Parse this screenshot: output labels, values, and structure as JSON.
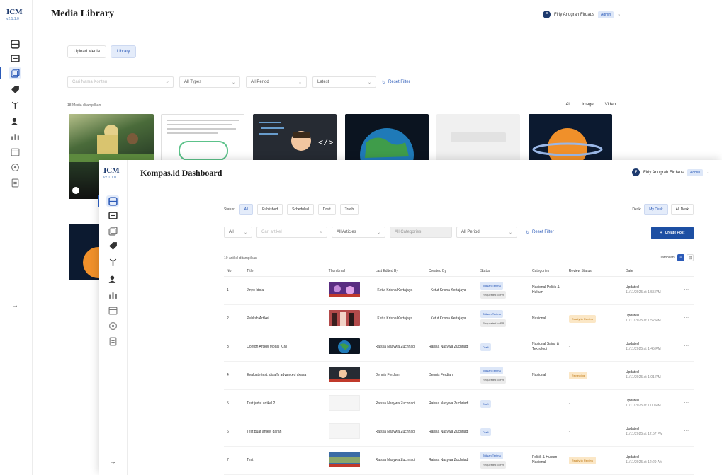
{
  "media_library": {
    "logo_main": "ICM",
    "logo_sub": "v2.1.1.0",
    "title": "Media Library",
    "user": {
      "avatar": "F",
      "name": "Firly Anugrah Firdaus",
      "role": "Admin",
      "chevron": "⌄"
    },
    "tabs": [
      {
        "label": "Upload Media"
      },
      {
        "label": "Library"
      }
    ],
    "filters": {
      "search_placeholder": "Cari Nama Konten",
      "type": "All Types",
      "period": "All Period",
      "sort": "Latest",
      "reset": "Reset Filter"
    },
    "count": "18 Media ditampilkan",
    "type_segments": [
      "All",
      "Image",
      "Video"
    ],
    "collapse_icon": "→"
  },
  "dashboard": {
    "logo_main": "ICM",
    "logo_sub": "v2.1.1.0",
    "title": "Kompas.id Dashboard",
    "user": {
      "avatar": "F",
      "name": "Firly Anugrah Firdaus",
      "role": "Admin",
      "chevron": "⌄"
    },
    "status_label": "Status:",
    "status_pills": [
      "All",
      "Published",
      "Scheduled",
      "Draft",
      "Trash"
    ],
    "desk_label": "Desk:",
    "desk_pills": [
      "My Desk",
      "All Desk"
    ],
    "filters": {
      "scope": "All",
      "search_placeholder": "Cari artikel",
      "articles": "All Articles",
      "categories": "All Categories",
      "period": "All Period",
      "reset": "Reset Filter"
    },
    "create_button": "Create Post",
    "count": "10 artikel ditampilkan",
    "view_label": "Tampilan:",
    "columns": [
      "No",
      "Title",
      "Thumbnail",
      "Last Edited By",
      "Created By",
      "Status",
      "Categories",
      "Review Status",
      "Date"
    ],
    "rows": [
      {
        "no": "1",
        "title": "Jinyo Idola",
        "edited": "I Ketut Krisna Kertajaya",
        "created": "I Ketut Krisna Kertajaya",
        "status": [
          "Tulisan Terima",
          "Requested to PR"
        ],
        "categories": "Nasional Politik & Hukum",
        "review": "-",
        "date_label": "Updated",
        "date": "11/11/2025 at 1:55 PM",
        "thumb": "purple"
      },
      {
        "no": "2",
        "title": "Publish Artikel",
        "edited": "I Ketut Krisna Kertajaya",
        "created": "I Ketut Krisna Kertajaya",
        "status": [
          "Tulisan Terima",
          "Requested to PR"
        ],
        "categories": "Nasional",
        "review": "Ready to Review",
        "date_label": "Updated",
        "date": "11/11/2025 at 1:52 PM",
        "thumb": "people"
      },
      {
        "no": "3",
        "title": "Contoh Artikel Modal ICM",
        "edited": "Raissa Nasywa Zuchriadi",
        "created": "Raissa Nasywa Zuchriadi",
        "status": [
          "Draft"
        ],
        "categories": "Nasional Sains & Teknologi",
        "review": "-",
        "date_label": "Updated",
        "date": "11/11/2025 at 1:45 PM",
        "thumb": "earth"
      },
      {
        "no": "4",
        "title": "Evaluate test: disaffs advanced dxasa",
        "edited": "Dennis Ferdian",
        "created": "Dennis Ferdian",
        "status": [
          "Tulisan Terima",
          "Requested to PR"
        ],
        "categories": "Nasional",
        "review": "Reviewing",
        "date_label": "Updated",
        "date": "11/11/2025 at 1:01 PM",
        "thumb": "cartoon"
      },
      {
        "no": "5",
        "title": "Test judul artikel 2",
        "edited": "Raissa Nasywa Zuchriadi",
        "created": "Raissa Nasywa Zuchriadi",
        "status": [
          "Draft"
        ],
        "categories": "",
        "review": "-",
        "date_label": "Updated",
        "date": "11/11/2025 at 1:00 PM",
        "thumb": "blank"
      },
      {
        "no": "6",
        "title": "Test buat artikel garah",
        "edited": "Raissa Nasywa Zuchriadi",
        "created": "Raissa Nasywa Zuchriadi",
        "status": [
          "Draft"
        ],
        "categories": "",
        "review": "-",
        "date_label": "Updated",
        "date": "11/11/2025 at 12:57 PM",
        "thumb": "blank"
      },
      {
        "no": "7",
        "title": "Test",
        "edited": "Raissa Nasywa Zuchriadi",
        "created": "Raissa Nasywa Zuchriadi",
        "status": [
          "Tulisan Terima",
          "Requested to PR"
        ],
        "categories": "Politik & Hukum Nasional",
        "review": "Ready to Review",
        "date_label": "Updated",
        "date": "11/11/2025 at 12:29 AM",
        "thumb": "crowd"
      }
    ],
    "row_action": "⋯",
    "collapse_icon": "→"
  }
}
